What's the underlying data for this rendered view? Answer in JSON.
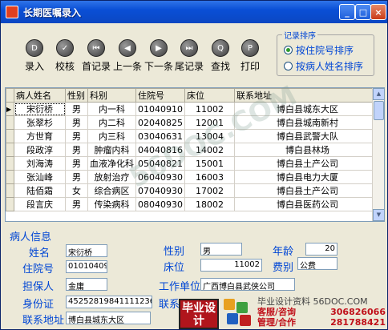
{
  "window": {
    "title": "长期医嘱录入"
  },
  "titlebar_buttons": [
    "_",
    "□",
    "×"
  ],
  "toolbar": {
    "tools": [
      {
        "label": "录入",
        "glyph": "D",
        "icon": "document-icon"
      },
      {
        "label": "校核",
        "glyph": "✓",
        "icon": "check-icon"
      },
      {
        "label": "首记录",
        "glyph": "⏮",
        "icon": "first-record-icon"
      },
      {
        "label": "上一条",
        "glyph": "◀",
        "icon": "previous-icon"
      },
      {
        "label": "下一条",
        "glyph": "▶",
        "icon": "next-icon"
      },
      {
        "label": "尾记录",
        "glyph": "⏭",
        "icon": "last-record-icon"
      },
      {
        "label": "查找",
        "glyph": "Q",
        "icon": "search-icon"
      },
      {
        "label": "打印",
        "glyph": "P",
        "icon": "print-icon"
      }
    ]
  },
  "sort": {
    "legend": "记录排序",
    "options": [
      {
        "label": "按住院号排序",
        "selected": true
      },
      {
        "label": "按病人姓名排序",
        "selected": false
      }
    ]
  },
  "grid": {
    "columns": [
      "病人姓名",
      "性别",
      "科别",
      "住院号",
      "床位",
      "联系地址"
    ],
    "rows": [
      [
        "宋衍桥",
        "男",
        "内一科",
        "01040910",
        "11002",
        "博白县城东大区"
      ],
      [
        "张翠杉",
        "男",
        "内二科",
        "02040825",
        "12001",
        "博白县城南新村"
      ],
      [
        "方世育",
        "男",
        "内三科",
        "03040631",
        "13004",
        "博白县武警大队"
      ],
      [
        "段政淳",
        "男",
        "肿瘤内科",
        "04040816",
        "14002",
        "博白县林场"
      ],
      [
        "刘海涛",
        "男",
        "血液净化科",
        "05040821",
        "15001",
        "博白县土产公司"
      ],
      [
        "张汕峰",
        "男",
        "放射治疗",
        "06040930",
        "16003",
        "博白县电力大厦"
      ],
      [
        "陆佰霜",
        "女",
        "综合病区",
        "07040930",
        "17002",
        "博白县土产公司"
      ],
      [
        "段言庆",
        "男",
        "传染病科",
        "08040930",
        "18002",
        "博白县医药公司"
      ]
    ]
  },
  "info": {
    "title": "病人信息",
    "name_label": "姓名",
    "name": "宋衍桥",
    "gender_label": "性别",
    "gender": "男",
    "age_label": "年龄",
    "age": "20",
    "admission_label": "住院号",
    "admission": "010104091",
    "bed_label": "床位",
    "bed": "11002",
    "fee_label": "费别",
    "fee": "公费",
    "guarantor_label": "担保人",
    "guarantor": "金庸",
    "employer_label": "工作单位",
    "employer": "广西博白县武侠公司",
    "id_label": "身份证",
    "id": "452528198411112363",
    "phone_label": "联系",
    "address_label": "联系地址",
    "address": "博白县城东大区"
  },
  "watermark": "56DOC.COM",
  "ad": {
    "logo": "毕业设计",
    "line1": "毕业设计资料 56DOC.COM",
    "service_label": "客服/咨询",
    "service_qq": "306826066",
    "manage_label": "管理/合作",
    "manage_qq": "281788421"
  },
  "colors": {
    "titlebar": "#0A4FD6",
    "label_blue": "#0046D5",
    "ad_red": "#C0101A"
  }
}
